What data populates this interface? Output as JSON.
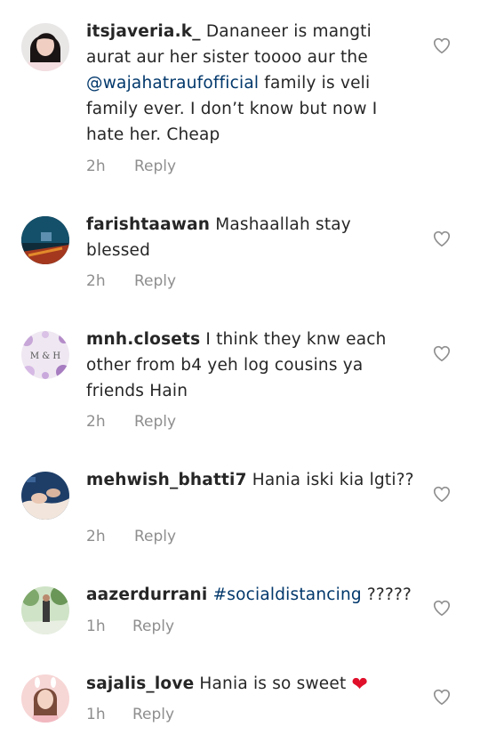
{
  "comments": [
    {
      "username": "itsjaveria.k_",
      "text_before": " Dananeer is mangti aurat aur her sister toooo aur the ",
      "mention": "@wajahatraufofficial",
      "text_after": " family is veli family ever. I don’t know but now I hate her. Cheap",
      "time": "2h",
      "reply": "Reply"
    },
    {
      "username": "farishtaawan",
      "text": " Mashaallah stay blessed",
      "time": "2h",
      "reply": "Reply"
    },
    {
      "username": "mnh.closets",
      "text": " I think they knw each other from b4 yeh log cousins ya friends Hain",
      "time": "2h",
      "reply": "Reply",
      "avatar_text": "M & H"
    },
    {
      "username": "mehwish_bhatti7",
      "text": " Hania iski kia lgti??",
      "time": "2h",
      "reply": "Reply"
    },
    {
      "username": "aazerdurrani",
      "hashtag": "#socialdistancing",
      "text": " ?????",
      "time": "1h",
      "reply": "Reply"
    },
    {
      "username": "sajalis_love",
      "text": " Hania is so sweet ",
      "emoji": "❤",
      "time": "1h",
      "reply": "Reply"
    }
  ],
  "icons": {
    "like": "heart-outline-icon"
  },
  "colors": {
    "text": "#262626",
    "secondary": "#8e8e8e",
    "link": "#00376b",
    "emoji_heart": "#e0102b"
  }
}
